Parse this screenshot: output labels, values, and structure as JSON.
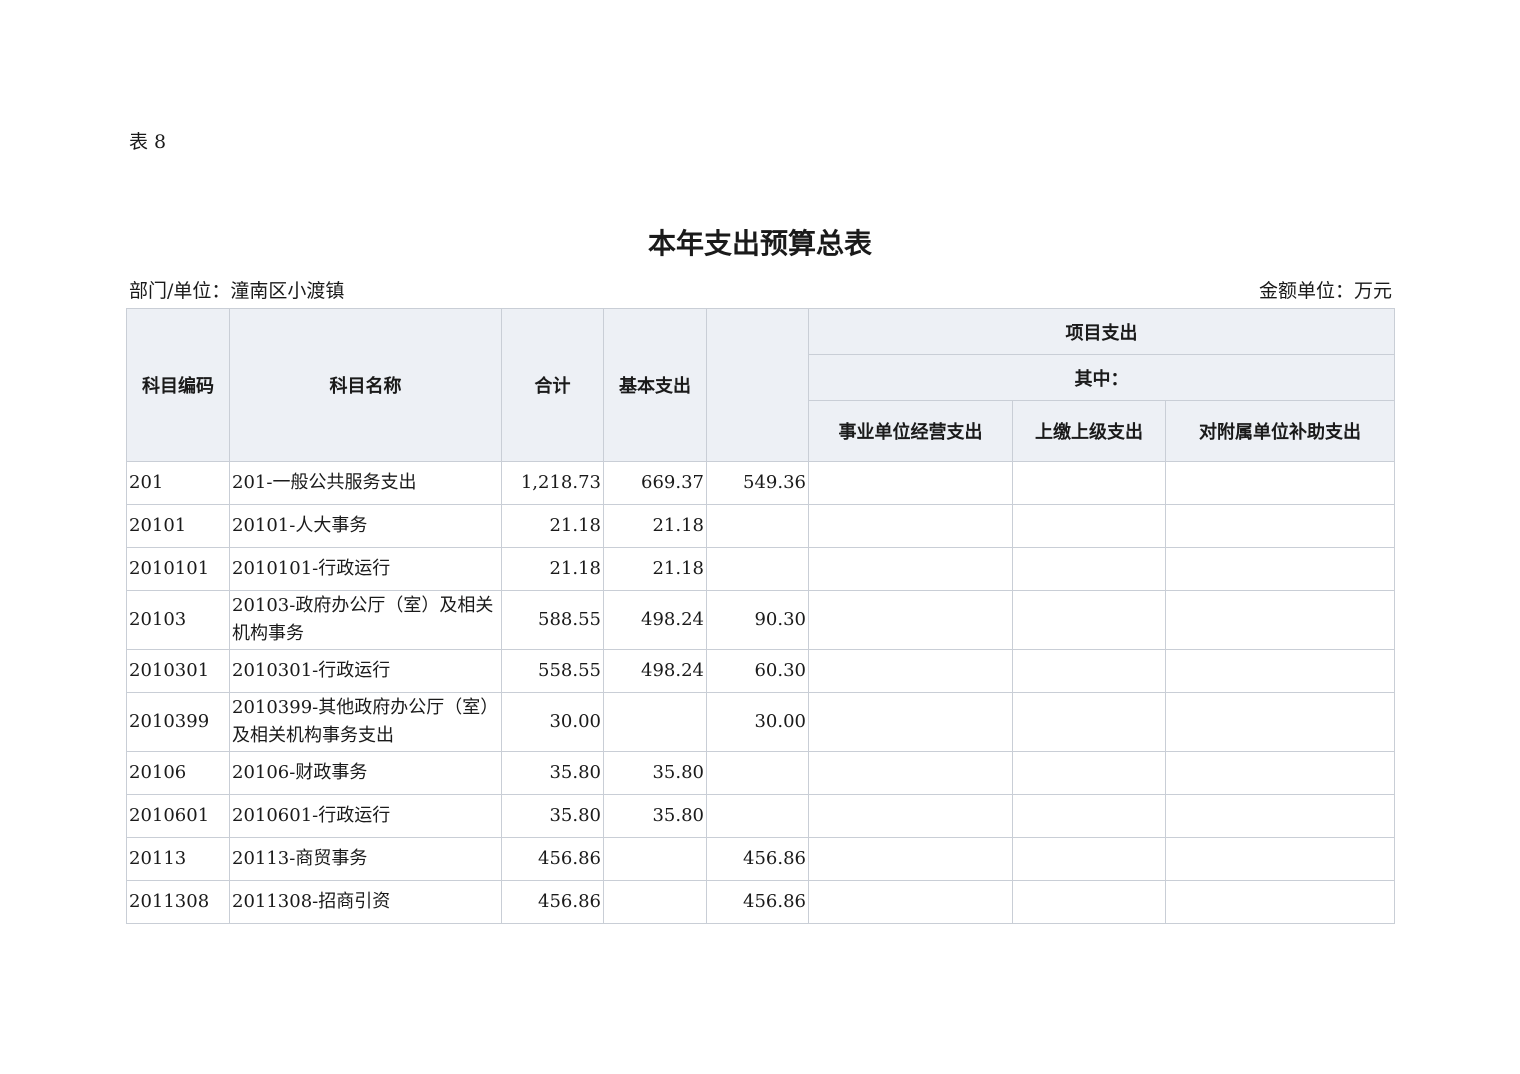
{
  "document": {
    "table_number": "表 8",
    "title": "本年支出预算总表",
    "department_label": "部门/单位：潼南区小渡镇",
    "unit_label": "金额单位：万元"
  },
  "table": {
    "headers": {
      "code": "科目编码",
      "name": "科目名称",
      "total": "合计",
      "basic": "基本支出",
      "project": "项目支出",
      "of_which": "其中：",
      "business": "事业单位经营支出",
      "upper": "上缴上级支出",
      "subsidy": "对附属单位补助支出"
    },
    "rows": [
      {
        "code": "201",
        "name": "201-一般公共服务支出",
        "total": "1,218.73",
        "basic": "669.37",
        "project": "549.36",
        "business": "",
        "upper": "",
        "subsidy": ""
      },
      {
        "code": "20101",
        "name": "20101-人大事务",
        "total": "21.18",
        "basic": "21.18",
        "project": "",
        "business": "",
        "upper": "",
        "subsidy": ""
      },
      {
        "code": "2010101",
        "name": "2010101-行政运行",
        "total": "21.18",
        "basic": "21.18",
        "project": "",
        "business": "",
        "upper": "",
        "subsidy": ""
      },
      {
        "code": "20103",
        "name": "20103-政府办公厅（室）及相关机构事务",
        "total": "588.55",
        "basic": "498.24",
        "project": "90.30",
        "business": "",
        "upper": "",
        "subsidy": ""
      },
      {
        "code": "2010301",
        "name": "2010301-行政运行",
        "total": "558.55",
        "basic": "498.24",
        "project": "60.30",
        "business": "",
        "upper": "",
        "subsidy": ""
      },
      {
        "code": "2010399",
        "name": "2010399-其他政府办公厅（室）及相关机构事务支出",
        "total": "30.00",
        "basic": "",
        "project": "30.00",
        "business": "",
        "upper": "",
        "subsidy": ""
      },
      {
        "code": "20106",
        "name": "20106-财政事务",
        "total": "35.80",
        "basic": "35.80",
        "project": "",
        "business": "",
        "upper": "",
        "subsidy": ""
      },
      {
        "code": "2010601",
        "name": "2010601-行政运行",
        "total": "35.80",
        "basic": "35.80",
        "project": "",
        "business": "",
        "upper": "",
        "subsidy": ""
      },
      {
        "code": "20113",
        "name": "20113-商贸事务",
        "total": "456.86",
        "basic": "",
        "project": "456.86",
        "business": "",
        "upper": "",
        "subsidy": ""
      },
      {
        "code": "2011308",
        "name": "2011308-招商引资",
        "total": "456.86",
        "basic": "",
        "project": "456.86",
        "business": "",
        "upper": "",
        "subsidy": ""
      }
    ]
  }
}
